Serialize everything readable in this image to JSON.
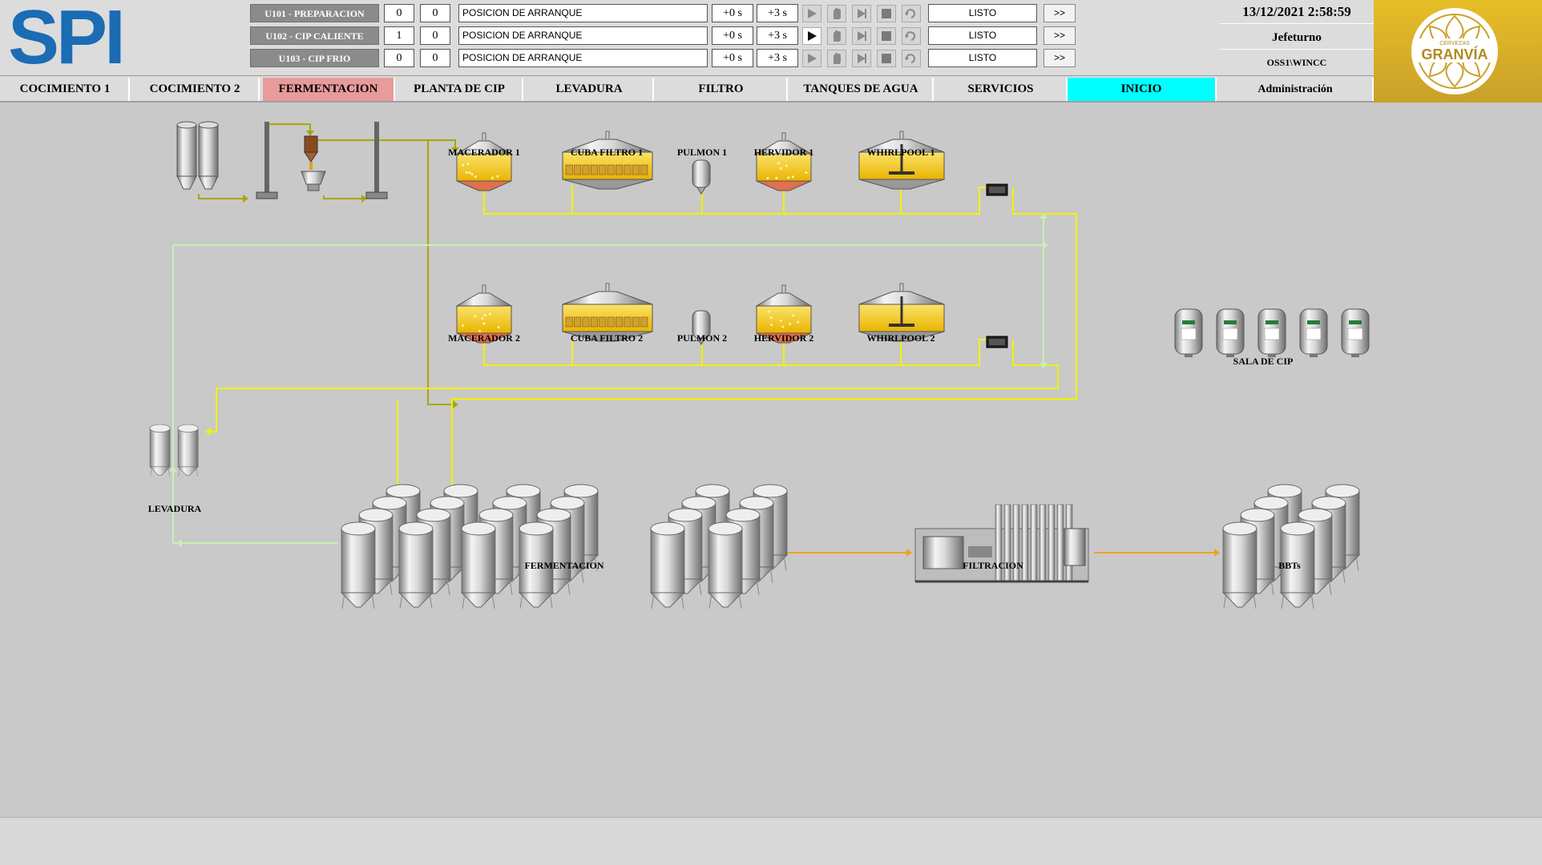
{
  "header": {
    "logo_text": "SPI",
    "units": [
      {
        "name": "U101 - PREPARACION",
        "val1": "0",
        "val2": "0",
        "step": "POSICION DE ARRANQUE",
        "t1": "+0 s",
        "t2": "+3 s",
        "status": "LISTO",
        "more": ">>",
        "running": false
      },
      {
        "name": "U102 - CIP CALIENTE",
        "val1": "1",
        "val2": "0",
        "step": "POSICION DE ARRANQUE",
        "t1": "+0 s",
        "t2": "+3 s",
        "status": "LISTO",
        "more": ">>",
        "running": true
      },
      {
        "name": "U103 - CIP FRIO",
        "val1": "0",
        "val2": "0",
        "step": "POSICION DE ARRANQUE",
        "t1": "+0 s",
        "t2": "+3 s",
        "status": "LISTO",
        "more": ">>",
        "running": false
      }
    ],
    "datetime": "13/12/2021 2:58:59",
    "user": "Jefeturno",
    "station": "OSS1\\WINCC",
    "brand": {
      "top": "CERVEZAS",
      "name": "GRANVÍA"
    }
  },
  "nav": {
    "tabs": [
      {
        "label": "COCIMIENTO 1",
        "state": "normal"
      },
      {
        "label": "COCIMIENTO 2",
        "state": "normal"
      },
      {
        "label": "FERMENTACION",
        "state": "active"
      },
      {
        "label": "PLANTA DE CIP",
        "state": "normal"
      },
      {
        "label": "LEVADURA",
        "state": "normal"
      },
      {
        "label": "FILTRO",
        "state": "normal"
      },
      {
        "label": "TANQUES DE AGUA",
        "state": "normal"
      },
      {
        "label": "SERVICIOS",
        "state": "normal"
      },
      {
        "label": "INICIO",
        "state": "home"
      },
      {
        "label": "Administración",
        "state": "normal"
      }
    ]
  },
  "scene": {
    "line1": {
      "macerador": "MACERADOR 1",
      "cuba": "CUBA FILTRO 1",
      "pulmon": "PULMON 1",
      "hervidor": "HERVIDOR 1",
      "whirlpool": "WHIRLPOOL 1"
    },
    "line2": {
      "macerador": "MACERADOR 2",
      "cuba": "CUBA FILTRO 2",
      "pulmon": "PULMON 2",
      "hervidor": "HERVIDOR 2",
      "whirlpool": "WHIRLPOOL 2"
    },
    "sala_cip": "SALA DE CIP",
    "levadura": "LEVADURA",
    "fermentacion": "FERMENTACION",
    "filtracion": "FILTRACION",
    "bbts": "BBTs",
    "colors": {
      "wort": "#f2f200",
      "green_line": "#c8f0b4",
      "orange_line": "#f0a020",
      "liquid": "#f5c820"
    }
  }
}
